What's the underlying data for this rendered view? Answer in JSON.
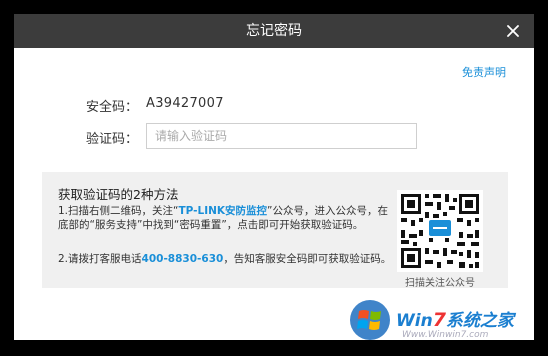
{
  "window": {
    "title": "忘记密码"
  },
  "header": {
    "disclaimer": "免责声明"
  },
  "form": {
    "security_code_label": "安全码：",
    "security_code_value": "A39427007",
    "verify_label": "验证码：",
    "verify_placeholder": "请输入验证码"
  },
  "info": {
    "title": "获取验证码的2种方法",
    "step1_a": "1.扫描右侧二维码，关注“",
    "step1_link": "TP-LINK安防监控",
    "step1_b": "”公众号，进入公众号，在底部的“服务支持”中找到“密码重置”，点击即可开始获取验证码。",
    "step2_a": "2.请拨打客服电话",
    "step2_phone": "400-8830-630",
    "step2_b": "，告知客服安全码即可获取验证码。",
    "qr_caption": "扫描关注公众号"
  },
  "watermark": {
    "brand_a": "Win",
    "brand_seven": "7",
    "brand_b": "系统之家",
    "url": "Www.Winwin7.com"
  },
  "colors": {
    "accent": "#1a8fd8",
    "titlebar": "#3c3c3c",
    "panel": "#f0f0f0"
  },
  "icons": {
    "close": "close-icon",
    "qr": "qr-code-icon"
  }
}
